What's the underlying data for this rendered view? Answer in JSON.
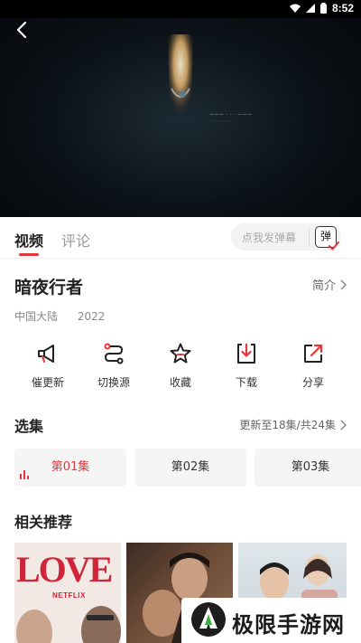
{
  "status_bar": {
    "time": "8:52"
  },
  "tabs": [
    {
      "label": "视频"
    },
    {
      "label": "评论"
    }
  ],
  "danmu": {
    "placeholder": "点我发弹幕",
    "button": "弹"
  },
  "show": {
    "title": "暗夜行者",
    "intro_label": "简介",
    "region": "中国大陆",
    "year": "2022"
  },
  "actions": [
    {
      "label": "催更新",
      "icon": "megaphone-icon"
    },
    {
      "label": "切换源",
      "icon": "switch-source-icon"
    },
    {
      "label": "收藏",
      "icon": "star-icon"
    },
    {
      "label": "下载",
      "icon": "download-icon"
    },
    {
      "label": "分享",
      "icon": "share-icon"
    }
  ],
  "episodes": {
    "title": "选集",
    "update_text": "更新至18集/共24集",
    "items": [
      {
        "label": "第01集",
        "active": true
      },
      {
        "label": "第02集",
        "active": false
      },
      {
        "label": "第03集",
        "active": false
      }
    ]
  },
  "recommend": {
    "title": "相关推荐",
    "posters": [
      {
        "lettering": "LOVE",
        "brand": "NETFLIX"
      },
      {},
      {}
    ]
  },
  "watermark": {
    "text": "极限手游网"
  },
  "colors": {
    "accent": "#e4393c",
    "player_bg": "#0b1116"
  }
}
